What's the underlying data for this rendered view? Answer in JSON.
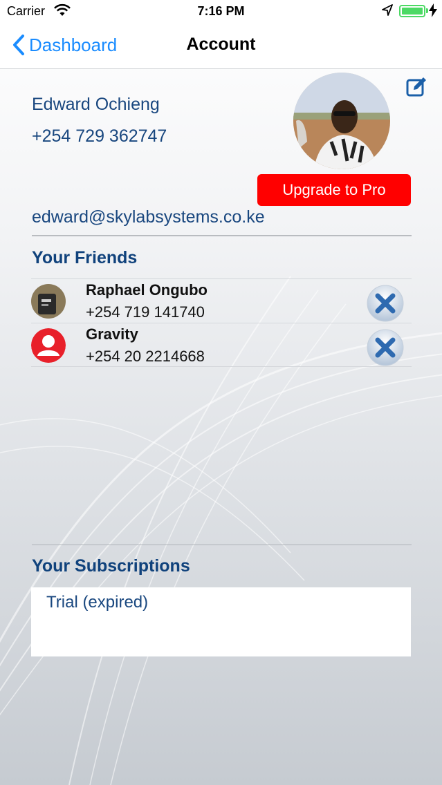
{
  "status_bar": {
    "carrier": "Carrier",
    "time": "7:16 PM"
  },
  "nav": {
    "back_label": "Dashboard",
    "title": "Account"
  },
  "profile": {
    "name": "Edward Ochieng",
    "phone": "+254 729 362747",
    "email": "edward@skylabsystems.co.ke",
    "upgrade_label": "Upgrade to Pro"
  },
  "friends": {
    "title": "Your Friends",
    "items": [
      {
        "name": "Raphael Ongubo",
        "phone": "+254 719 141740"
      },
      {
        "name": "Gravity",
        "phone": "+254 20 2214668"
      }
    ]
  },
  "subscriptions": {
    "title": "Your Subscriptions",
    "items": [
      "Trial (expired)"
    ]
  },
  "colors": {
    "accent": "#1a8cff",
    "text_blue": "#19477f",
    "upgrade": "#ff0000"
  }
}
